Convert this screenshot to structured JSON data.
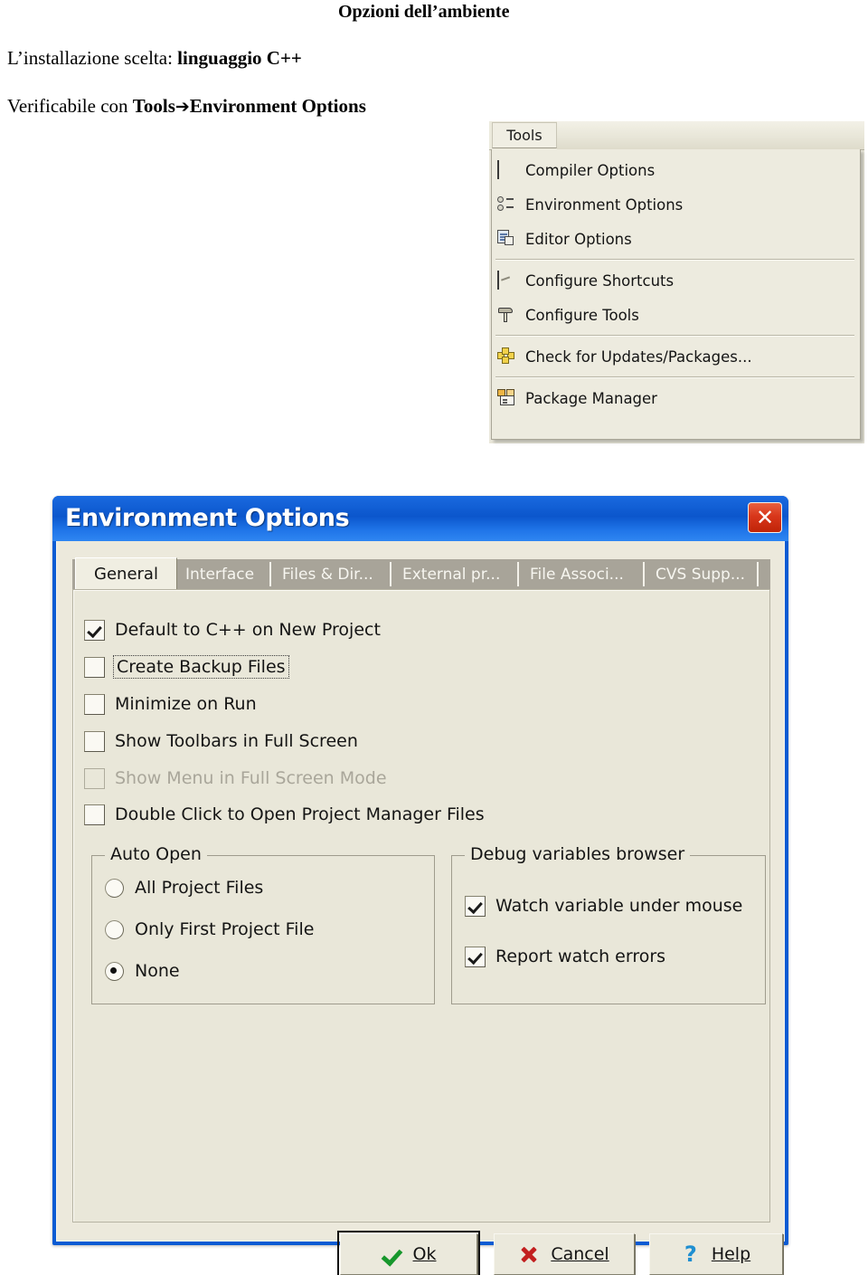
{
  "slide": {
    "title": "Opzioni dell’ambiente",
    "install_prefix": "L’installazione scelta:  ",
    "install_bold": "linguaggio C++",
    "verify_prefix": "Verificabile con ",
    "verify_tools": "Tools",
    "verify_arrow": "➔",
    "verify_target": "Environment Options"
  },
  "tools_menu": {
    "menu_button": "Tools",
    "groups": [
      {
        "items": [
          {
            "label": "Compiler Options",
            "icon": "compiler-options-icon"
          },
          {
            "label": "Environment Options",
            "icon": "environment-options-icon"
          },
          {
            "label": "Editor Options",
            "icon": "editor-options-icon"
          }
        ]
      },
      {
        "items": [
          {
            "label": "Configure Shortcuts",
            "icon": "configure-shortcuts-icon"
          },
          {
            "label": "Configure Tools",
            "icon": "hammer-icon"
          }
        ]
      },
      {
        "items": [
          {
            "label": "Check for Updates/Packages...",
            "icon": "puzzle-update-icon"
          }
        ]
      },
      {
        "items": [
          {
            "label": "Package Manager",
            "icon": "package-manager-icon"
          }
        ]
      }
    ]
  },
  "dialog": {
    "title": "Environment Options",
    "close_label": "✕",
    "tabs": [
      {
        "label": "General",
        "active": true
      },
      {
        "label": "Interface",
        "active": false
      },
      {
        "label": "Files & Dir...",
        "active": false
      },
      {
        "label": "External pr...",
        "active": false
      },
      {
        "label": "File Associ...",
        "active": false
      },
      {
        "label": "CVS Supp...",
        "active": false
      }
    ],
    "checkboxes": [
      {
        "label": "Default to C++ on New Project",
        "checked": true,
        "disabled": false,
        "focused": false
      },
      {
        "label": "Create Backup Files",
        "checked": false,
        "disabled": false,
        "focused": true
      },
      {
        "label": "Minimize on Run",
        "checked": false,
        "disabled": false,
        "focused": false
      },
      {
        "label": "Show Toolbars in Full Screen",
        "checked": false,
        "disabled": false,
        "focused": false
      },
      {
        "label": "Show Menu in Full Screen Mode",
        "checked": false,
        "disabled": true,
        "focused": false
      },
      {
        "label": "Double Click to Open Project Manager Files",
        "checked": false,
        "disabled": false,
        "focused": false
      }
    ],
    "auto_open": {
      "title": "Auto Open",
      "options": [
        {
          "label": "All Project Files",
          "selected": false
        },
        {
          "label": "Only First Project File",
          "selected": false
        },
        {
          "label": "None",
          "selected": true
        }
      ]
    },
    "debug_browser": {
      "title": "Debug variables browser",
      "options": [
        {
          "label": "Watch variable under mouse",
          "checked": true
        },
        {
          "label": "Report watch errors",
          "checked": true
        }
      ]
    },
    "buttons": {
      "ok": "Ok",
      "cancel": "Cancel",
      "help": "Help"
    }
  },
  "colors": {
    "titlebar_blue": "#0b56cc",
    "dialog_face": "#ece9dc",
    "panel_face": "#e9e7d9",
    "tabstrip_gray": "#a8a499",
    "close_red": "#d8361a",
    "ok_green": "#17972c",
    "cancel_red": "#c21f1f",
    "help_blue": "#1f8fd1"
  }
}
